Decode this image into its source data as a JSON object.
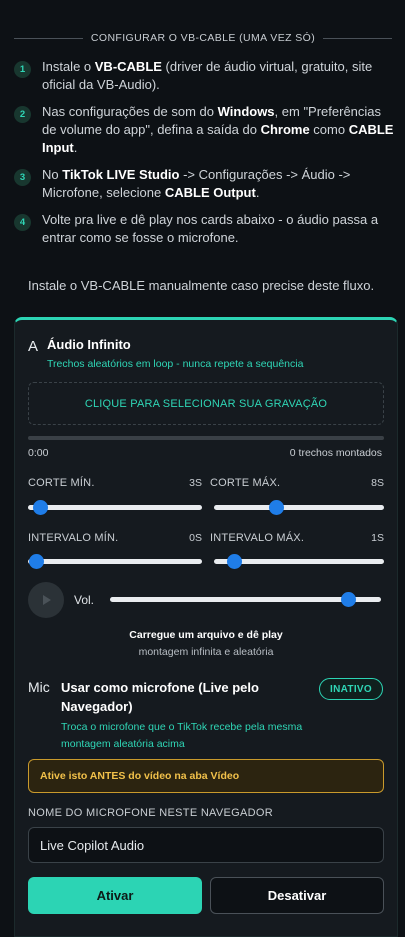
{
  "setup": {
    "title": "CONFIGURAR O VB-CABLE (UMA VEZ SÓ)",
    "steps": [
      {
        "num": "1",
        "parts": [
          {
            "t": "Instale o ",
            "b": false
          },
          {
            "t": "VB-CABLE",
            "b": true
          },
          {
            "t": " (driver de áudio virtual, gratuito, site oficial da VB-Audio).",
            "b": false
          }
        ]
      },
      {
        "num": "2",
        "parts": [
          {
            "t": "Nas configurações de som do ",
            "b": false
          },
          {
            "t": "Windows",
            "b": true
          },
          {
            "t": ", em \"Preferências de volume do app\", defina a saída do ",
            "b": false
          },
          {
            "t": "Chrome",
            "b": true
          },
          {
            "t": " como ",
            "b": false
          },
          {
            "t": "CABLE Input",
            "b": true
          },
          {
            "t": ".",
            "b": false
          }
        ]
      },
      {
        "num": "3",
        "parts": [
          {
            "t": "No ",
            "b": false
          },
          {
            "t": "TikTok LIVE Studio",
            "b": true
          },
          {
            "t": " -> Configurações -> Áudio -> Microfone, selecione ",
            "b": false
          },
          {
            "t": "CABLE Output",
            "b": true
          },
          {
            "t": ".",
            "b": false
          }
        ]
      },
      {
        "num": "4",
        "parts": [
          {
            "t": "Volte pra live e dê play nos cards abaixo - o áudio passa a entrar como se fosse o microfone.",
            "b": false
          }
        ]
      }
    ],
    "manual_note": "Instale o VB-CABLE manualmente caso precise deste fluxo."
  },
  "card": {
    "title_letter": "A",
    "title": "Áudio Infinito",
    "subtitle": "Trechos aleatórios em loop - nunca repete a sequência",
    "dropzone_label": "CLIQUE PARA SELECIONAR SUA GRAVAÇÃO",
    "progress": 0,
    "time_start": "0:00",
    "segment_count": "0 trechos montados",
    "sliders": [
      {
        "label": "CORTE MÍN.",
        "value_text": "3S",
        "level": 0.07
      },
      {
        "label": "CORTE MÁX.",
        "value_text": "8S",
        "level": 0.37
      },
      {
        "label": "INTERVALO MÍN.",
        "value_text": "0S",
        "level": 0.05
      },
      {
        "label": "INTERVALO MÁX.",
        "value_text": "1S",
        "level": 0.12
      }
    ],
    "volume": {
      "label": "Vol.",
      "level": 0.88
    },
    "hint_strong": "Carregue um arquivo e dê play",
    "hint_sub": "montagem infinita e aleatória",
    "mic": {
      "prefix": "Mic",
      "title": "Usar como microfone (Live pelo Navegador)",
      "status": "INATIVO",
      "description": "Troca o microfone que o TikTok recebe pela mesma montagem aleatória acima",
      "warning": "Ative isto ANTES do vídeo na aba Vídeo",
      "name_label": "NOME DO MICROFONE NESTE NAVEGADOR",
      "name_value": "Live Copilot Audio",
      "activate_label": "Ativar",
      "deactivate_label": "Desativar"
    }
  },
  "colors": {
    "accent": "#2cd4b4",
    "slider_thumb": "#1f7de8",
    "warning": "#f2c14a"
  },
  "icons": {
    "play": "play-icon"
  }
}
